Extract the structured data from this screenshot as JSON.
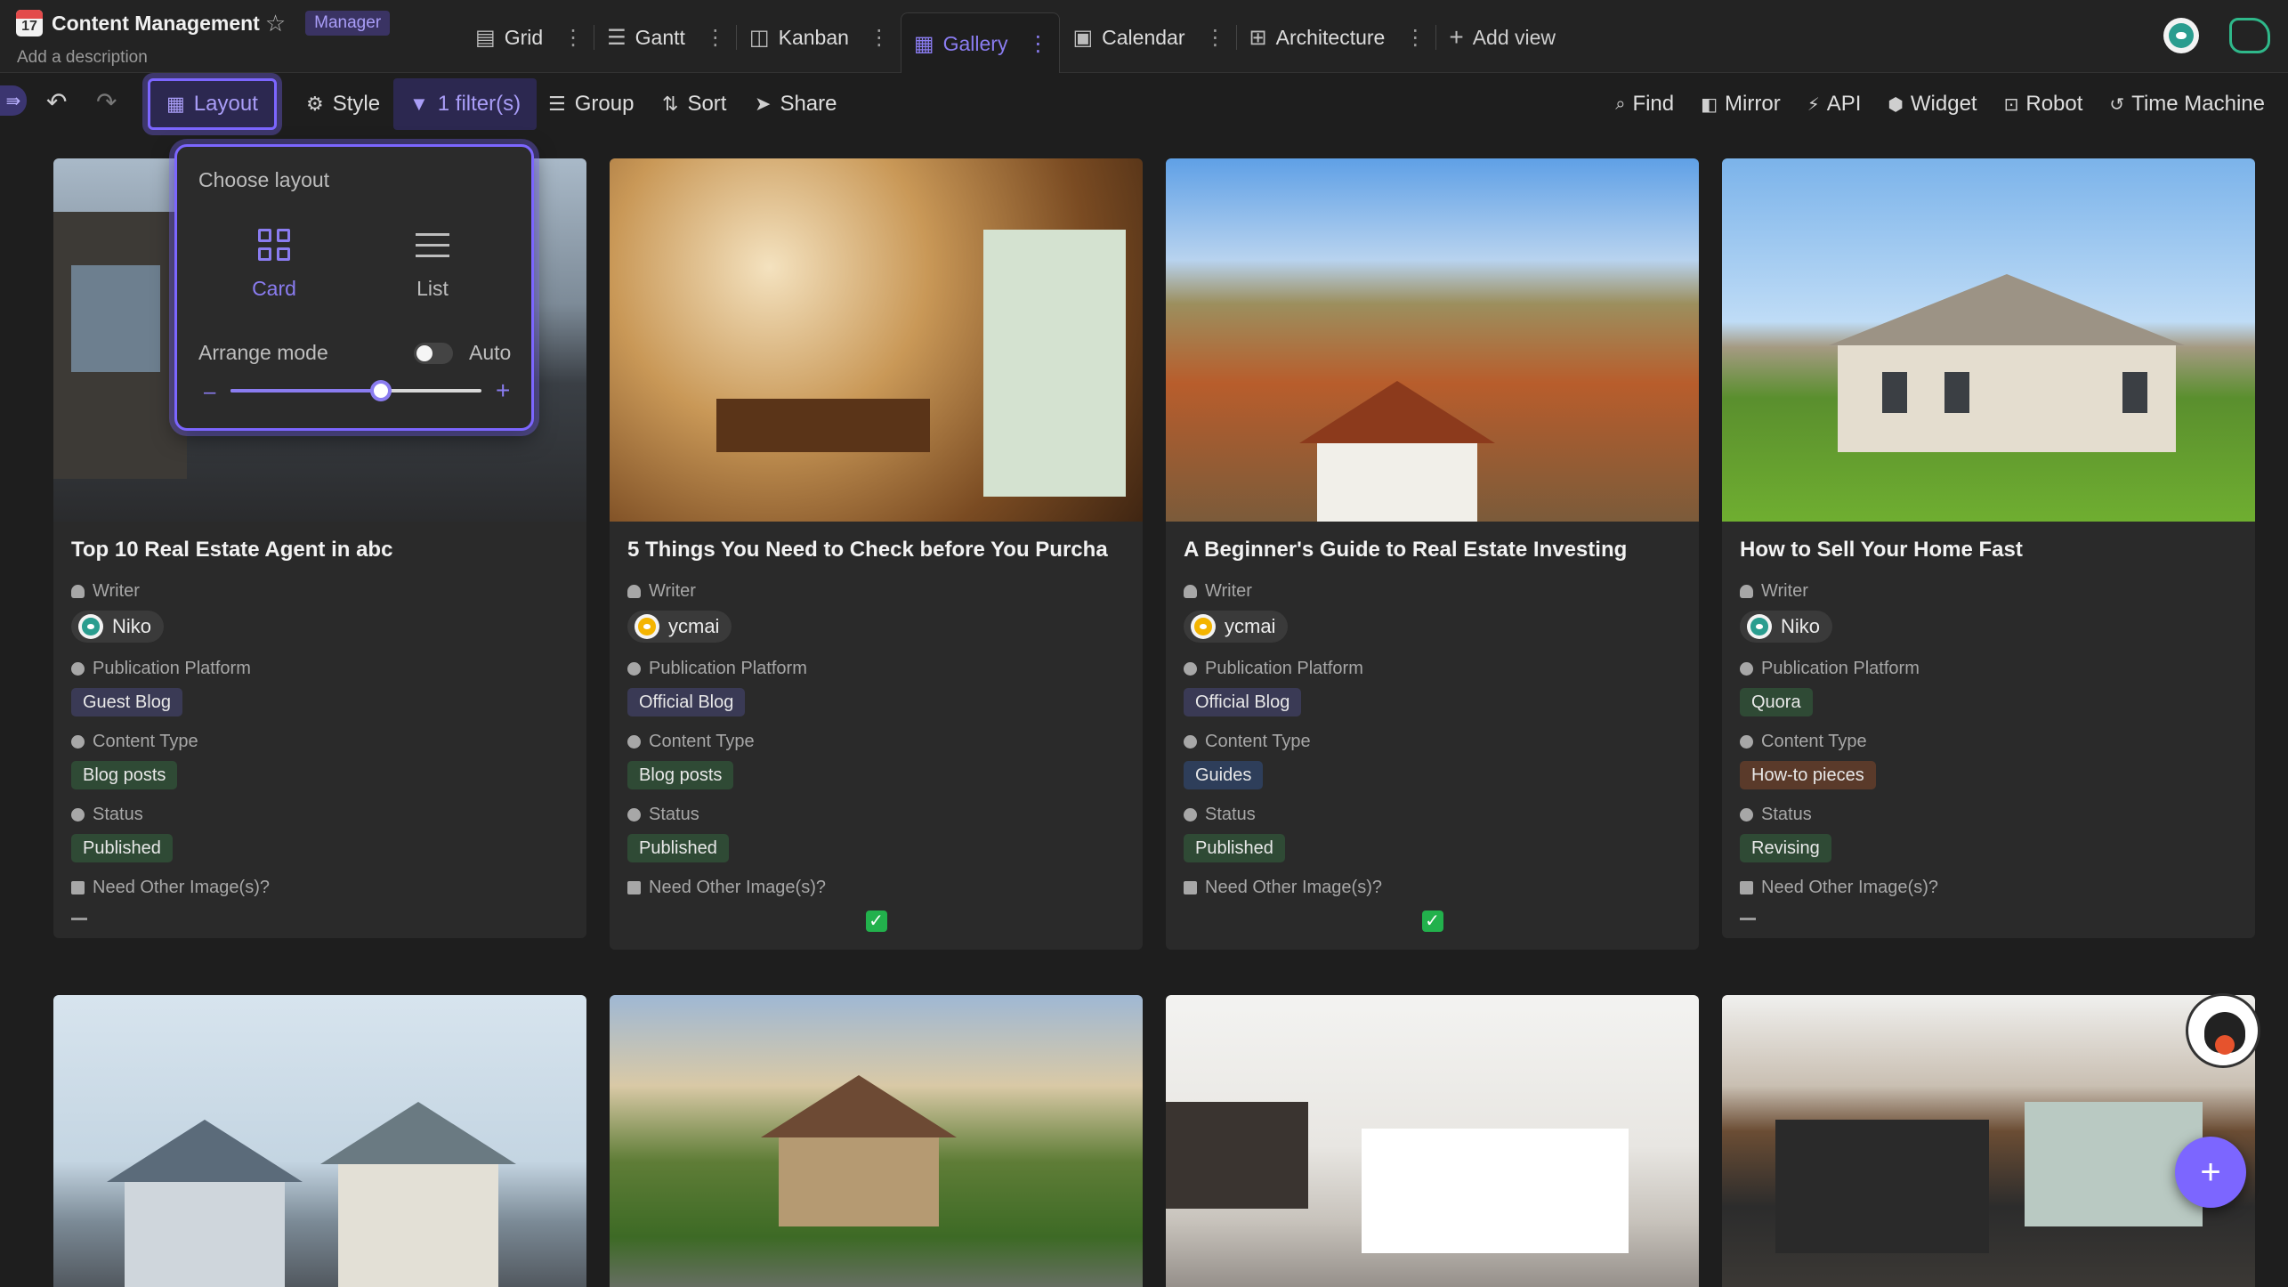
{
  "header": {
    "app_icon_text": "17",
    "title": "Content Management",
    "role": "Manager",
    "description": "Add a description"
  },
  "views": [
    {
      "label": "Grid",
      "icon": "grid-icon"
    },
    {
      "label": "Gantt",
      "icon": "gantt-icon"
    },
    {
      "label": "Kanban",
      "icon": "kanban-icon"
    },
    {
      "label": "Gallery",
      "icon": "gallery-icon",
      "active": true
    },
    {
      "label": "Calendar",
      "icon": "calendar-icon"
    },
    {
      "label": "Architecture",
      "icon": "architecture-icon"
    }
  ],
  "add_view_label": "Add view",
  "toolbar": {
    "layout": "Layout",
    "style": "Style",
    "filter": "1 filter(s)",
    "group": "Group",
    "sort": "Sort",
    "share": "Share",
    "right": [
      "Find",
      "Mirror",
      "API",
      "Widget",
      "Robot",
      "Time Machine"
    ]
  },
  "layout_popover": {
    "title": "Choose layout",
    "options": [
      "Card",
      "List"
    ],
    "selected": "Card",
    "arrange_label": "Arrange mode",
    "auto_label": "Auto",
    "auto_enabled": false,
    "size_slider_fraction": 0.6,
    "minus": "–",
    "plus": "+"
  },
  "field_labels": {
    "writer": "Writer",
    "platform": "Publication Platform",
    "type": "Content Type",
    "status": "Status",
    "images": "Need Other Image(s)?"
  },
  "cards": [
    {
      "title": "Top 10 Real Estate Agent in abc",
      "writer": "Niko",
      "platform": "Guest Blog",
      "type": "Blog posts",
      "status": "Published",
      "need_images": false,
      "scene": "coast"
    },
    {
      "title": "5 Things You Need to Check before You Purcha",
      "writer": "ycmai",
      "platform": "Official Blog",
      "type": "Blog posts",
      "status": "Published",
      "need_images": true,
      "scene": "kitchen"
    },
    {
      "title": "A Beginner's Guide to Real Estate Investing",
      "writer": "ycmai",
      "platform": "Official Blog",
      "type": "Guides",
      "status": "Published",
      "need_images": true,
      "scene": "village"
    },
    {
      "title": "How to Sell Your Home Fast",
      "writer": "Niko",
      "platform": "Quora",
      "type": "How-to pieces",
      "status": "Revising",
      "need_images": false,
      "scene": "house"
    }
  ],
  "check_mark": "✓",
  "fab_label": "+"
}
